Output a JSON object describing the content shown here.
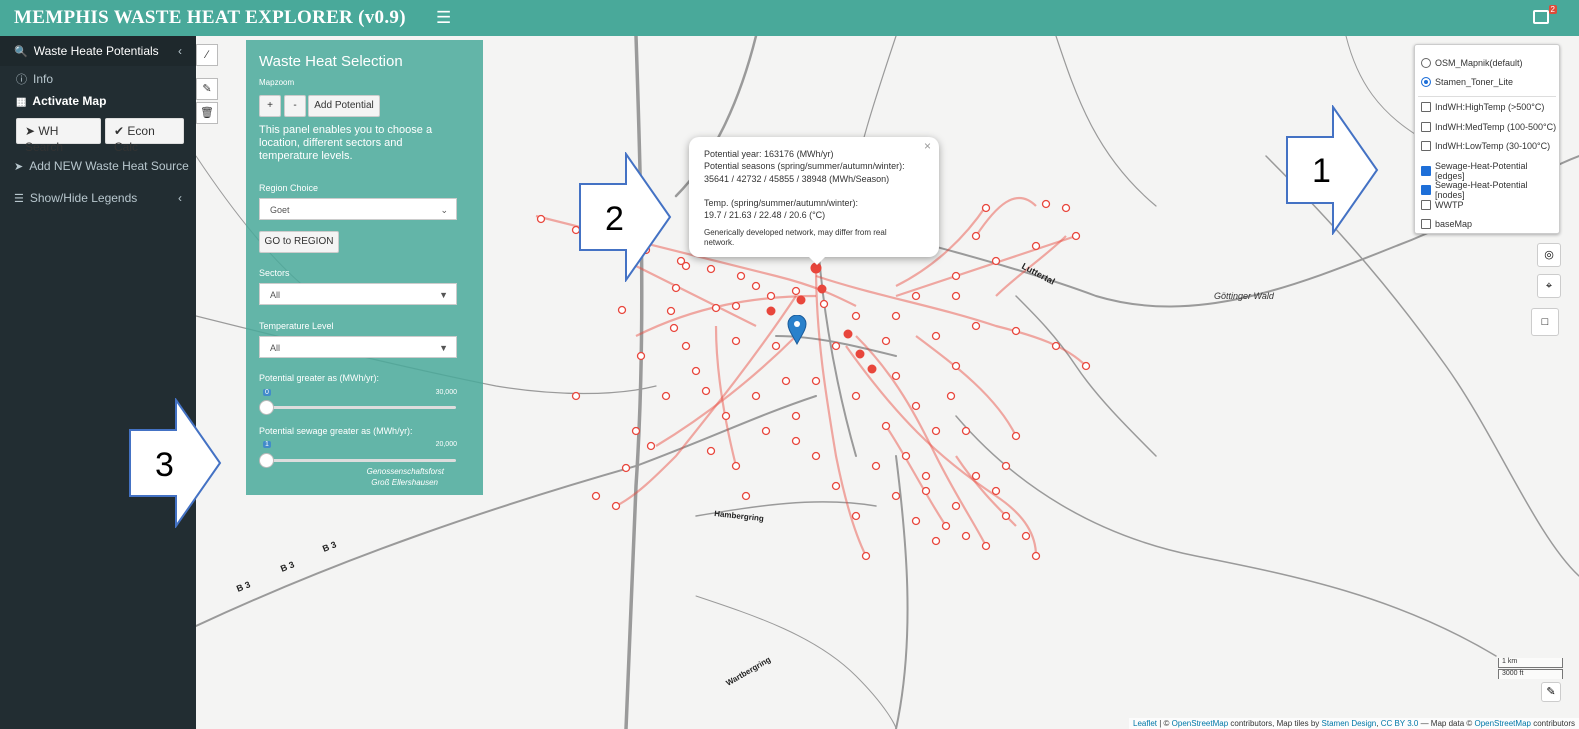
{
  "header": {
    "title": "MEMPHIS WASTE HEAT EXPLORER (v0.9)",
    "menu_icon": "hamburger-icon",
    "notif_count": "2"
  },
  "sidebar": {
    "section_title": "Waste Heate Potentials",
    "info_label": "Info",
    "activate_map_label": "Activate Map",
    "wh_search_label": "WH Search",
    "econ_calc_label": "Econ Calc",
    "add_source_label": "Add NEW Waste Heat Source",
    "legends_label": "Show/Hide Legends"
  },
  "panel": {
    "title": "Waste Heat Selection",
    "mapzoom_label": "Mapzoom",
    "zoom_in": "+",
    "zoom_out": "-",
    "add_potential": "Add Potential",
    "description": "This panel enables you to choose a location, different sectors and temperature levels.",
    "region_label": "Region Choice",
    "region_value": "Goet",
    "go_region": "GO to REGION",
    "sectors_label": "Sectors",
    "sectors_value": "All",
    "temp_label": "Temperature Level",
    "temp_value": "All",
    "potential_label": "Potential greater as (MWh/yr):",
    "potential_min": "0",
    "potential_max": "30,000",
    "potential_value": 0,
    "sewage_label": "Potential sewage greater as (MWh/yr):",
    "sewage_min": "1",
    "sewage_max": "20,000",
    "sewage_value": 0
  },
  "layers": {
    "base": [
      {
        "label": "OSM_Mapnik(default)",
        "checked": false
      },
      {
        "label": "Stamen_Toner_Lite",
        "checked": true
      }
    ],
    "overlays": [
      {
        "label": "IndWH:HighTemp (>500°C)",
        "checked": false
      },
      {
        "label": "IndWH:MedTemp (100-500°C)",
        "checked": false
      },
      {
        "label": "IndWH:LowTemp (30-100°C)",
        "checked": false
      },
      {
        "label": "Sewage-Heat-Potential [edges]",
        "checked": true
      },
      {
        "label": "Sewage-Heat-Potential [nodes]",
        "checked": true
      },
      {
        "label": "WWTP",
        "checked": false
      },
      {
        "label": "baseMap",
        "checked": false
      }
    ]
  },
  "popup": {
    "line1": "Potential year: 163176 (MWh/yr)",
    "line2": "Potential seasons (spring/summer/autumn/winter):",
    "line3": "35641 / 42732 / 45855 / 38948 (MWh/Season)",
    "line4": "Temp. (spring/summer/autumn/winter):",
    "line5": "19.7 / 21.63 / 22.48 / 20.6 (°C)",
    "line6": "Generically developed network, may differ from real network.",
    "close": "×"
  },
  "map_labels": {
    "luttertal": "Luttertal",
    "gottinger_wald": "Göttinger Wald",
    "hambergring": "Hambergring",
    "wartberg": "Wartbergring",
    "b3a": "B 3",
    "b3b": "B 3",
    "b3c": "B 3",
    "forest1": "Genossenschaftsforst",
    "forest2": "Groß Ellershausen"
  },
  "scale": {
    "km": "1 km",
    "ft": "3000 ft"
  },
  "attribution": {
    "leaflet": "Leaflet",
    "text1": " | © ",
    "osm": "OpenStreetMap",
    "text2": " contributors, Map tiles by ",
    "stamen": "Stamen Design",
    "text3": ", ",
    "cc": "CC BY 3.0",
    "text4": " — Map data © ",
    "osm2": "OpenStreetMap",
    "text5": " contributors"
  },
  "callouts": {
    "c1": "1",
    "c2": "2",
    "c3": "3"
  },
  "colors": {
    "header": "#49a99a",
    "sidebar": "#222d32",
    "network": "#e8463c",
    "marker": "#2a81cb"
  }
}
